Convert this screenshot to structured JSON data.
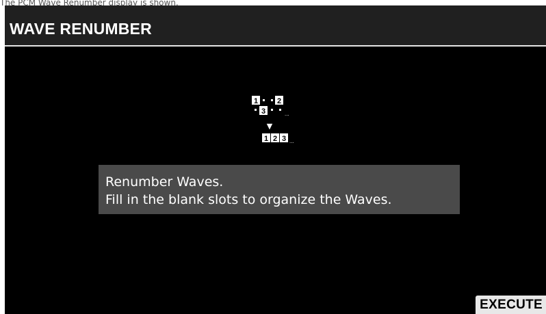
{
  "caption": "The PCM Wave Renumber display is shown.",
  "header": {
    "title": "WAVE RENUMBER"
  },
  "diagram": {
    "before_slots": [
      "1",
      "2",
      "3"
    ],
    "after_slots": [
      "1",
      "2",
      "3"
    ],
    "ellipsis": "...",
    "arrow": "▼"
  },
  "message": {
    "line1": "Renumber Waves.",
    "line2": "Fill in the blank slots to organize the Waves."
  },
  "footer": {
    "execute_label": "EXECUTE"
  }
}
